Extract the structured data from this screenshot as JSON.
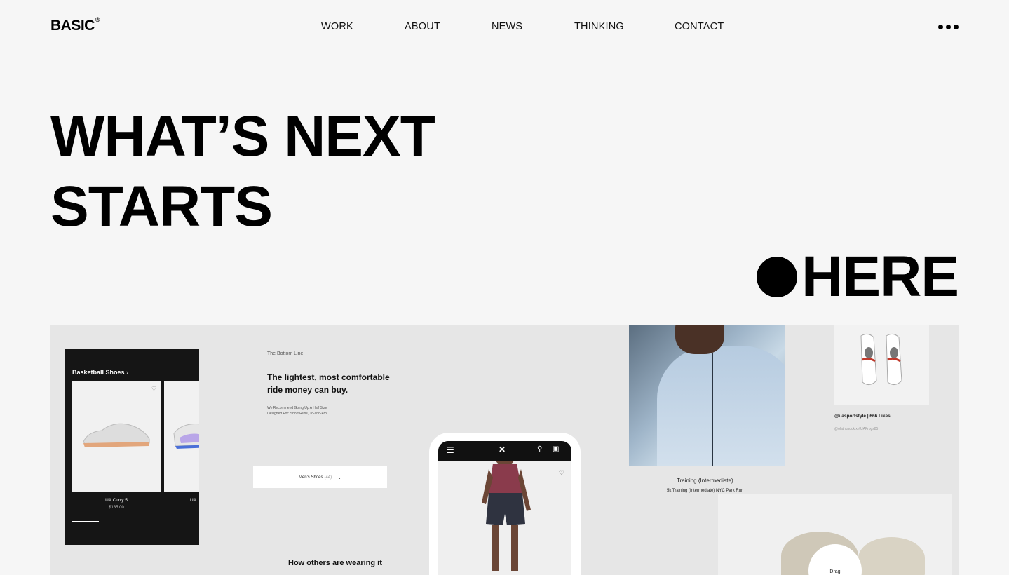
{
  "header": {
    "logo": "BASIC",
    "logo_mark": "®",
    "nav": [
      "WORK",
      "ABOUT",
      "NEWS",
      "THINKING",
      "CONTACT"
    ],
    "menu_icon": "more-dots-icon"
  },
  "hero": {
    "line1": "WHAT’S NEXT",
    "line2": "STARTS",
    "line3": "HERE"
  },
  "showcase": {
    "card1": {
      "title": "Basketball Shoes",
      "product1_name": "UA Curry 5",
      "product1_price": "$135.00",
      "product2_name": "UA I"
    },
    "card2": {
      "label": "The Bottom Line",
      "headline": "The lightest, most comfortable ride money can buy.",
      "small_line1": "We Recommend Going Up A Half Size",
      "small_line2": "Designed For: Short Runs, To-and-Fro",
      "select_label": "Men's Shoes",
      "select_count": "(44)",
      "section_title": "How others are wearing it"
    },
    "phone": {
      "brand_icon": "under-armour-logo-icon"
    },
    "card3": {
      "caption": "Training (Intermediate)",
      "link": "5k Training (Intermediate) NYC Park Run"
    },
    "insta": {
      "handle": "@uasportstyle | 666 Likes",
      "tags": "@olathusuck x #UAFrogs85"
    },
    "drag_label": "Drag"
  }
}
